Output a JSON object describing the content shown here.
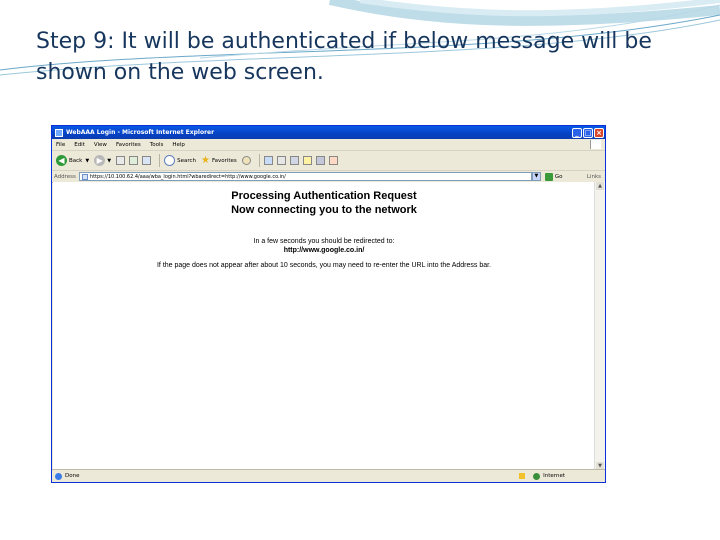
{
  "slide": {
    "title": "Step 9: It will be authenticated if below message will be shown on the web screen."
  },
  "browser": {
    "window_title": "WebAAA Login - Microsoft Internet Explorer",
    "menu": [
      "File",
      "Edit",
      "View",
      "Favorites",
      "Tools",
      "Help"
    ],
    "toolbar": {
      "back_label": "Back",
      "search_label": "Search",
      "favorites_label": "Favorites"
    },
    "address": {
      "label": "Address",
      "url": "https://10.100.62.4/aaa/wba_login.html?wbaredirect=http://www.google.co.in/",
      "go_label": "Go",
      "links_label": "Links"
    },
    "page": {
      "heading_line1": "Processing Authentication Request",
      "heading_line2": "Now connecting you to the network",
      "redirect_text": "In a few seconds you should be redirected to:",
      "redirect_url": "http://www.google.co.in/",
      "note": "If the page does not appear after about 10 seconds, you may need to re-enter the URL into the Address bar."
    },
    "status": {
      "left": "Done",
      "zone": "Internet"
    }
  },
  "colors": {
    "title_text": "#17365d",
    "titlebar_blue": "#0542c4",
    "chrome": "#ece9d8"
  }
}
